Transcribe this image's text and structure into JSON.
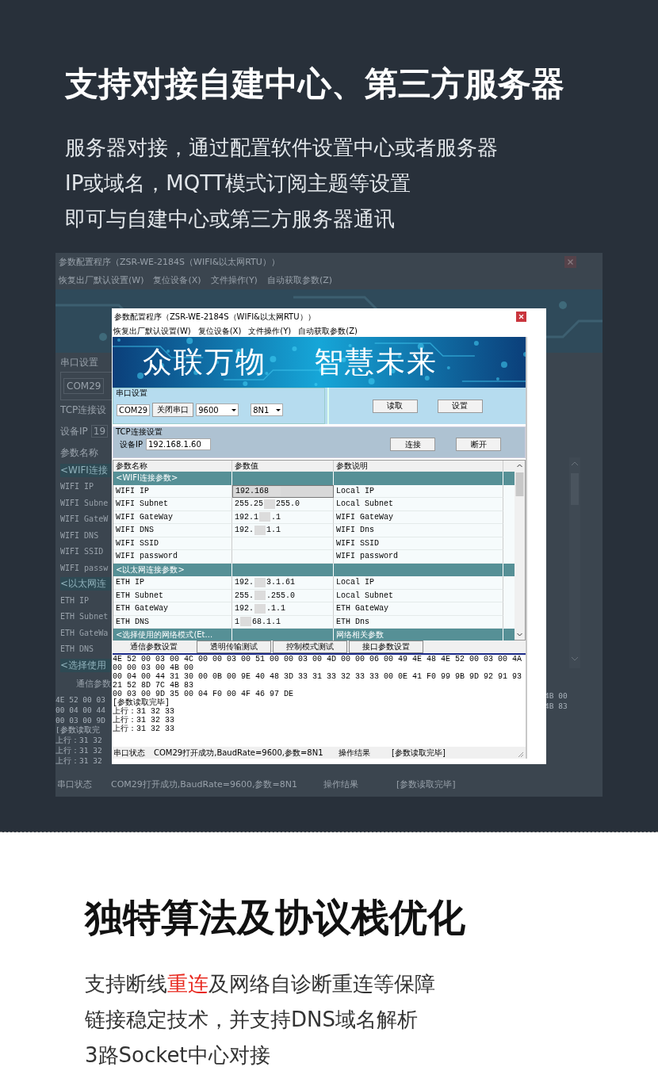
{
  "heading": "支持对接自建中心、第三方服务器",
  "intro_lines": [
    "服务器对接，通过配置软件设置中心或者服务器",
    "IP或域名，MQTT模式订阅主题等设置",
    "即可与自建中心或第三方服务器通讯"
  ],
  "background_window": {
    "title": "参数配置程序（ZSR-WE-2184S（WIFI&以太网RTU））",
    "menu": [
      "恢复出厂默认设置(W)",
      "复位设备(X)",
      "文件操作(Y)",
      "自动获取参数(Z)"
    ],
    "left_column": [
      {
        "kind": "group",
        "text": "串口设置"
      },
      {
        "kind": "field",
        "text": "COM29"
      },
      {
        "kind": "group",
        "text": "TCP连接设"
      },
      {
        "kind": "ip",
        "text": "设备IP",
        "value": "19"
      },
      {
        "kind": "column",
        "text": "参数名称"
      },
      {
        "kind": "section",
        "text": "<WIFI连接"
      },
      {
        "kind": "param",
        "text": "WIFI IP"
      },
      {
        "kind": "param",
        "text": "WIFI Subne"
      },
      {
        "kind": "param",
        "text": "WIFI GateW"
      },
      {
        "kind": "param",
        "text": "WIFI DNS"
      },
      {
        "kind": "param",
        "text": "WIFI SSID"
      },
      {
        "kind": "param",
        "text": "WIFI passw"
      },
      {
        "kind": "section",
        "text": "<以太网连"
      },
      {
        "kind": "param",
        "text": "ETH IP"
      },
      {
        "kind": "param",
        "text": "ETH Subnet"
      },
      {
        "kind": "param",
        "text": "ETH GateWa"
      },
      {
        "kind": "param",
        "text": "ETH DNS"
      },
      {
        "kind": "section",
        "text": "<选择使用"
      },
      {
        "kind": "tab",
        "text": "通信参数"
      },
      {
        "kind": "log",
        "text": "4E 52 00 03"
      },
      {
        "kind": "log",
        "text": "00 04 00 44"
      },
      {
        "kind": "log",
        "text": "00 03 00 9D"
      },
      {
        "kind": "log",
        "text": "[参数读取完"
      },
      {
        "kind": "log",
        "text": "上行：31 32"
      },
      {
        "kind": "log",
        "text": "上行：31 32"
      },
      {
        "kind": "log",
        "text": "上行：31 32"
      }
    ],
    "right_log": [
      "4B 00",
      "4B 83"
    ],
    "status_bar": [
      "串口状态",
      "COM29打开成功,BaudRate=9600,参数=8N1",
      "操作结果",
      "[参数读取完毕]"
    ]
  },
  "window": {
    "title": "参数配置程序（ZSR-WE-2184S（WIFI&以太网RTU））",
    "menu": [
      "恢复出厂默认设置(W)",
      "复位设备(X)",
      "文件操作(Y)",
      "自动获取参数(Z)"
    ],
    "banner": [
      "众联万物",
      "智慧未来"
    ],
    "serial": {
      "group_title": "串口设置",
      "port": "COM29",
      "open_button": "关闭串口",
      "baud": "9600",
      "format": "8N1",
      "read_button": "读取",
      "set_button": "设置"
    },
    "tcp": {
      "group_title": "TCP连接设置",
      "ip_label": "设备IP",
      "ip": "192.168.1.60",
      "connect_button": "连接",
      "disconnect_button": "断开"
    },
    "table": {
      "columns": [
        "参数名称",
        "参数值",
        "参数说明"
      ],
      "rows": [
        {
          "kind": "section",
          "name": "<WIFI连接参数>",
          "desc": ""
        },
        {
          "kind": "param",
          "name": "WIFI IP",
          "value_start": "192.168",
          "value_end": "",
          "desc": "Local IP",
          "selected": true
        },
        {
          "kind": "param",
          "name": "WIFI Subnet",
          "value_start": "255.25",
          "value_end": "255.0",
          "desc": "Local Subnet",
          "selected": false
        },
        {
          "kind": "param",
          "name": "WIFI GateWay",
          "value_start": "192.1",
          "value_end": ".1",
          "desc": "WIFI GateWay",
          "selected": false
        },
        {
          "kind": "param",
          "name": "WIFI DNS",
          "value_start": "192.",
          "value_end": "1.1",
          "desc": "WIFI Dns",
          "selected": false
        },
        {
          "kind": "param",
          "name": "WIFI SSID",
          "value_start": "",
          "value_end": "",
          "desc": "WIFI SSID",
          "selected": false
        },
        {
          "kind": "param",
          "name": "WIFI password",
          "value_start": "",
          "value_end": "",
          "desc": "WIFI password",
          "selected": false
        },
        {
          "kind": "section",
          "name": "<以太网连接参数>",
          "desc": ""
        },
        {
          "kind": "param",
          "name": "ETH IP",
          "value_start": "192.",
          "value_end": "3.1.61",
          "desc": "Local IP",
          "selected": false
        },
        {
          "kind": "param",
          "name": "ETH Subnet",
          "value_start": "255.",
          "value_end": ".255.0",
          "desc": "Local Subnet",
          "selected": false
        },
        {
          "kind": "param",
          "name": "ETH GateWay",
          "value_start": "192.",
          "value_end": ".1.1",
          "desc": "ETH GateWay",
          "selected": false
        },
        {
          "kind": "param",
          "name": "ETH DNS",
          "value_start": "1",
          "value_end": "68.1.1",
          "desc": "ETH Dns",
          "selected": false
        },
        {
          "kind": "section",
          "name": "<选择使用的网络模式(Et...",
          "desc": "网络相关参数"
        }
      ]
    },
    "tabs": [
      {
        "label": "通信参数设置",
        "selected": true
      },
      {
        "label": "透明传输测试",
        "selected": false
      },
      {
        "label": "控制模式测试",
        "selected": false
      },
      {
        "label": "接口参数设置",
        "selected": false
      }
    ],
    "log_lines": [
      "4E 52 00 03 00 4C 00 00 03 00 51 00 00 03 00 4D 00 00 06 00 49 4E 48 4E 52 00 03 00 4A 00 00 03 00 4B 00",
      "00 04 00 44 31 30 00 0B 00 9E 40 48 3D 33 31 33 32 33 33 00 0E 41 F0 99 9B 9D 92 91 93 21 52 8D 7C 4B 83",
      "00 03 00 9D 35 00 04 F0 00 4F 46 97 DE",
      "[参数读取完毕]",
      "上行：31 32 33",
      "上行：31 32 33",
      "上行：31 32 33"
    ],
    "status_bar": [
      "串口状态",
      "COM29打开成功,BaudRate=9600,参数=8N1",
      "操作结果",
      "[参数读取完毕]"
    ]
  },
  "section2": {
    "heading": "独特算法及协议栈优化",
    "lines": [
      [
        {
          "text": "支持断线",
          "highlight": false
        },
        {
          "text": "重连",
          "highlight": true
        },
        {
          "text": "及网络自诊断重连等保障",
          "highlight": false
        }
      ],
      [
        {
          "text": "链接稳定技术，并支持DNS域名解析",
          "highlight": false
        }
      ],
      [
        {
          "text": "3路Socket中心对接",
          "highlight": false
        }
      ]
    ]
  }
}
